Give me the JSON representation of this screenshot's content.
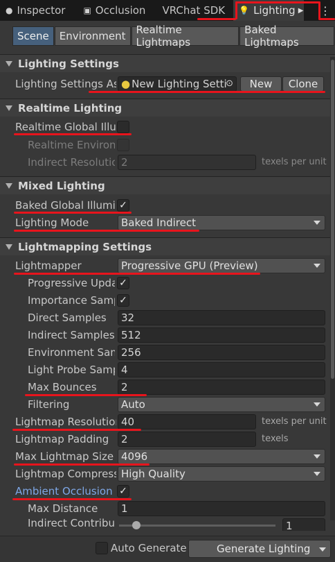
{
  "tabs": [
    {
      "label": "Inspector",
      "icon": "info-icon"
    },
    {
      "label": "Occlusion",
      "icon": "occlusion-icon"
    },
    {
      "label": "VRChat SDK",
      "icon": ""
    },
    {
      "label": "Lighting",
      "icon": "bulb-icon"
    }
  ],
  "subtabs": [
    "Scene",
    "Environment",
    "Realtime Lightmaps",
    "Baked Lightmaps"
  ],
  "sections": {
    "lighting_settings": "Lighting Settings",
    "realtime_lighting": "Realtime Lighting",
    "mixed_lighting": "Mixed Lighting",
    "lightmapping_settings": "Lightmapping Settings"
  },
  "lighting_settings": {
    "asset_label": "Lighting Settings As",
    "asset_value": "New Lighting Setti",
    "new_button": "New",
    "clone_button": "Clone"
  },
  "realtime": {
    "gi_label": "Realtime Global Illum",
    "env_label": "Realtime Environr",
    "indirect_label": "Indirect Resolutio",
    "indirect_value": "2",
    "unit": "texels per unit"
  },
  "mixed": {
    "baked_gi_label": "Baked Global Illumir",
    "mode_label": "Lighting Mode",
    "mode_value": "Baked Indirect"
  },
  "lightmapping": {
    "lightmapper_label": "Lightmapper",
    "lightmapper_value": "Progressive GPU (Preview)",
    "progressive_label": "Progressive Upda",
    "importance_label": "Importance Samp",
    "direct_label": "Direct Samples",
    "direct_value": "32",
    "indirect_label": "Indirect Samples",
    "indirect_value": "512",
    "env_label": "Environment Sam",
    "env_value": "256",
    "probe_label": "Light Probe Samp",
    "probe_value": "4",
    "bounces_label": "Max Bounces",
    "bounces_value": "2",
    "filtering_label": "Filtering",
    "filtering_value": "Auto",
    "resolution_label": "Lightmap Resolution",
    "resolution_value": "40",
    "resolution_unit": "texels per unit",
    "padding_label": "Lightmap Padding",
    "padding_value": "2",
    "padding_unit": "texels",
    "size_label": "Max Lightmap Size",
    "size_value": "4096",
    "compress_label": "Lightmap Compress",
    "compress_value": "High Quality",
    "ao_label": "Ambient Occlusion",
    "max_distance_label": "Max Distance",
    "max_distance_value": "1",
    "indirect_contrib_label": "Indirect Contribut",
    "indirect_contrib_value": "1"
  },
  "footer": {
    "auto_generate_label": "Auto Generate",
    "generate_button": "Generate Lighting"
  },
  "colors": {
    "annotation": "#e8141c",
    "accent": "#46607c",
    "ao_label": "#7ea7e6"
  }
}
